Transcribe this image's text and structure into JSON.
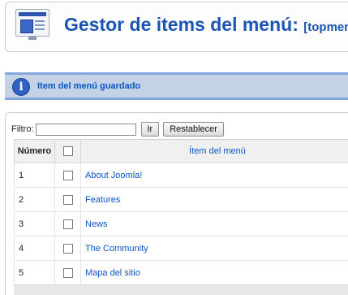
{
  "header": {
    "title": "Gestor de items del menú:",
    "menu_name": "[topmenu]",
    "icon": "menu-manager-icon"
  },
  "message": {
    "icon": "info-icon",
    "icon_glyph": "i",
    "text": "Item del menú guardado"
  },
  "filter": {
    "label": "Filtro:",
    "value": "",
    "go_label": "Ir",
    "reset_label": "Restablecer"
  },
  "table": {
    "columns": {
      "number": "Número",
      "title": "Ítem del menú"
    },
    "rows": [
      {
        "number": "1",
        "title": "About Joomla!"
      },
      {
        "number": "2",
        "title": "Features"
      },
      {
        "number": "3",
        "title": "News"
      },
      {
        "number": "4",
        "title": "The Community"
      },
      {
        "number": "5",
        "title": "Mapa del sitio"
      }
    ]
  },
  "colors": {
    "accent": "#1a54b5",
    "link": "#0b55c4",
    "message_bg": "#c3d2e5",
    "message_border": "#84a7db"
  }
}
